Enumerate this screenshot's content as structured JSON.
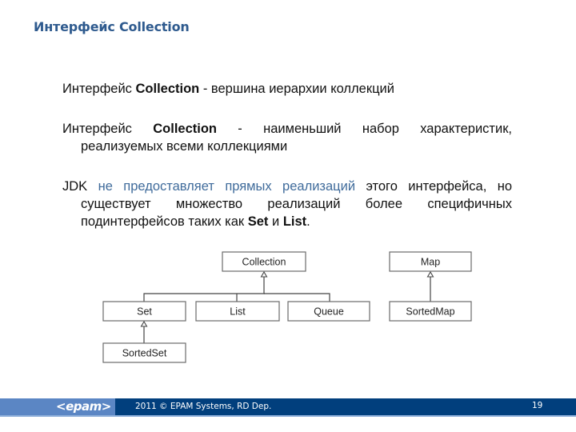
{
  "slide": {
    "title": "Интерфейс Collection",
    "page_number": "19"
  },
  "paragraphs": {
    "p1": {
      "pre": "Интерфейс ",
      "bold": "Collection",
      "post": " - вершина иерархии коллекций"
    },
    "p2": {
      "line1_pre": "Интерфейс ",
      "line1_bold": "Collection",
      "line1_post": " - наименьший набор характеристик,",
      "line2": "реализуемых всеми коллекциями"
    },
    "p3": {
      "line1_pre": "JDK ",
      "line1_highlight": "не предоставляет прямых реализаций",
      "line1_post": " этого интерфейса, но",
      "line2": "существует множество реализаций более специфичных",
      "line3_pre": "подинтерфейсов таких как ",
      "line3_bold1": "Set",
      "line3_mid": " и ",
      "line3_bold2": "List",
      "line3_end": "."
    }
  },
  "diagram": {
    "nodes": {
      "collection": "Collection",
      "set": "Set",
      "list": "List",
      "queue": "Queue",
      "sortedset": "SortedSet",
      "map": "Map",
      "sortedmap": "SortedMap"
    },
    "edges": [
      {
        "from": "set",
        "to": "collection"
      },
      {
        "from": "list",
        "to": "collection"
      },
      {
        "from": "queue",
        "to": "collection"
      },
      {
        "from": "sortedset",
        "to": "set"
      },
      {
        "from": "sortedmap",
        "to": "map"
      }
    ]
  },
  "footer": {
    "logo": "<epam>",
    "copyright": "2011 © EPAM Systems, RD Dep."
  },
  "colors": {
    "title": "#2E5A8E",
    "highlight_text": "#3F6B9B",
    "footer_dark": "#013F7D",
    "footer_light": "#5B86C4"
  }
}
